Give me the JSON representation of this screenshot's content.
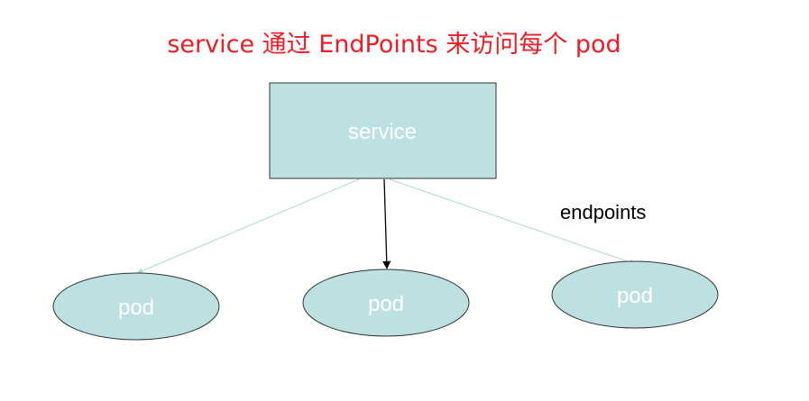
{
  "title": "service 通过 EndPoints 来访问每个 pod",
  "service": {
    "label": "service"
  },
  "pods": [
    {
      "label": "pod"
    },
    {
      "label": "pod"
    },
    {
      "label": "pod"
    }
  ],
  "edge_label": "endpoints",
  "colors": {
    "title": "#ee1c25",
    "node_fill": "#bde0e2",
    "node_stroke": "#333333",
    "node_text": "#ffffff",
    "arrow_light": "#aed8d8",
    "arrow_dark": "#000000"
  }
}
